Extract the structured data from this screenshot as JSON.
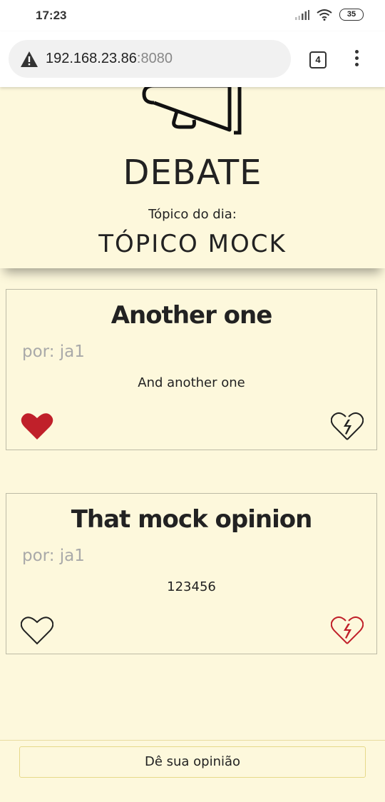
{
  "status_bar": {
    "time": "17:23",
    "battery": "35"
  },
  "browser": {
    "url_host": "192.168.23.86",
    "url_port": ":8080",
    "tab_count": "4"
  },
  "header": {
    "title": "DEBATE",
    "subtitle": "Tópico do dia:",
    "topic": "TÓPICO MOCK"
  },
  "opinions": [
    {
      "title": "Another one",
      "author": "por: ja1",
      "body": "And another one",
      "liked": true,
      "disliked": false
    },
    {
      "title": "That mock opinion",
      "author": "por: ja1",
      "body": "123456",
      "liked": false,
      "disliked": true
    }
  ],
  "footer": {
    "button_label": "Dê sua opinião"
  },
  "colors": {
    "background": "#fdf8dc",
    "heart_active": "#c0202a",
    "outline": "#222222"
  }
}
